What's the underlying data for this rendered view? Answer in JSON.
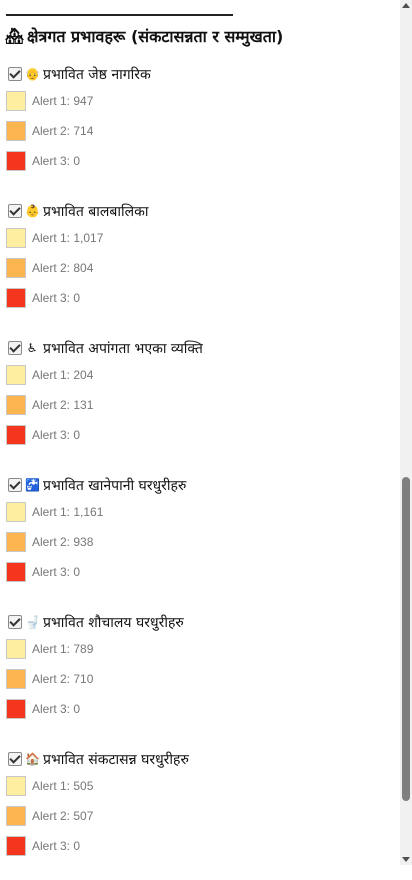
{
  "section": {
    "icon": "🏘",
    "title": "क्षेत्रगत प्रभावहरू (संकटासन्नता र सम्मुखता)"
  },
  "colors": {
    "alert1": "#fdeea0",
    "alert2": "#fdb54f",
    "alert3": "#f4361e"
  },
  "layers": [
    {
      "icon": "👴",
      "label": "प्रभावित जेष्ठ नागरिक",
      "alerts": [
        "Alert 1: 947",
        "Alert 2: 714",
        "Alert 3: 0"
      ]
    },
    {
      "icon": "👶",
      "label": "प्रभावित बालबालिका",
      "alerts": [
        "Alert 1: 1,017",
        "Alert 2: 804",
        "Alert 3: 0"
      ]
    },
    {
      "icon": "♿",
      "label": "प्रभावित अपांगता भएका व्यक्ति",
      "alerts": [
        "Alert 1: 204",
        "Alert 2: 131",
        "Alert 3: 0"
      ]
    },
    {
      "icon": "🚰",
      "label": "प्रभावित खानेपानी घरधुरीहरु",
      "alerts": [
        "Alert 1: 1,161",
        "Alert 2: 938",
        "Alert 3: 0"
      ]
    },
    {
      "icon": "🚽",
      "label": "प्रभावित शौचालय घरधुरीहरु",
      "alerts": [
        "Alert 1: 789",
        "Alert 2: 710",
        "Alert 3: 0"
      ]
    },
    {
      "icon": "🏠",
      "label": "प्रभावित संकटासन्न घरधुरीहरु",
      "alerts": [
        "Alert 1: 505",
        "Alert 2: 507",
        "Alert 3: 0"
      ]
    }
  ]
}
